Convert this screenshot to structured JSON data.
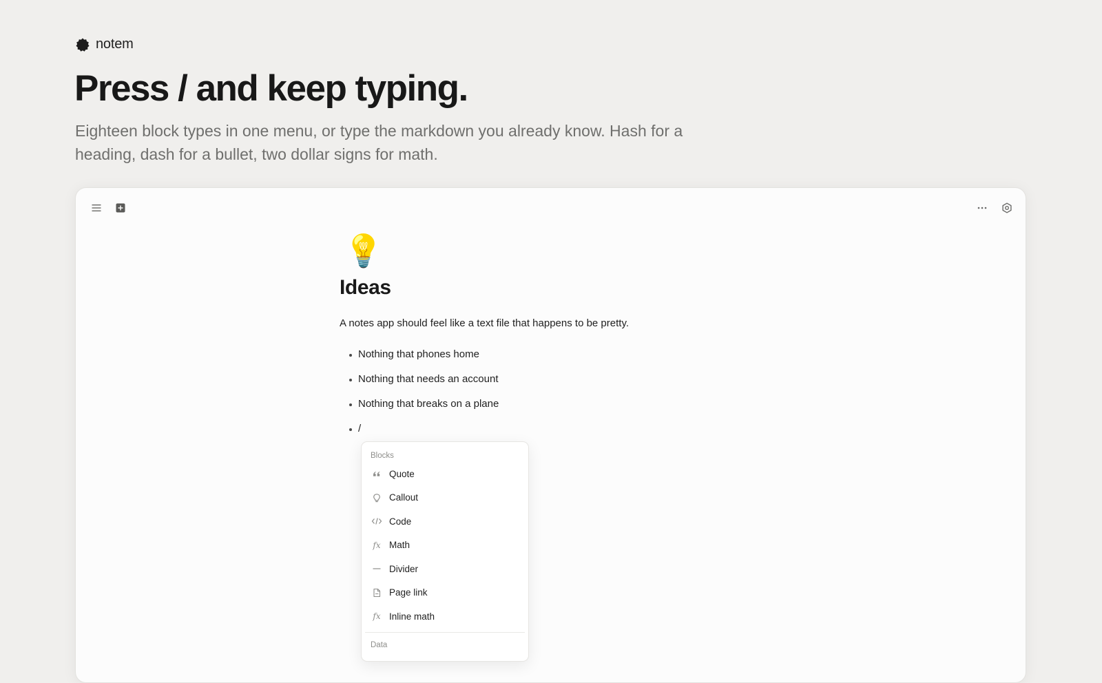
{
  "brand": {
    "name": "notem"
  },
  "hero": {
    "title": "Press / and keep typing.",
    "subtitle": "Eighteen block types in one menu, or type the markdown you already know. Hash for a heading, dash for a bullet, two dollar signs for math."
  },
  "toolbar": {
    "left_icons": [
      "menu-icon",
      "new-page-icon"
    ],
    "right_icons": [
      "more-icon",
      "settings-icon"
    ]
  },
  "document": {
    "emoji": "💡",
    "title": "Ideas",
    "paragraph": "A notes app should feel like a text file that happens to be pretty.",
    "bullets": [
      "Nothing that phones home",
      "Nothing that needs an account",
      "Nothing that breaks on a plane",
      "/"
    ]
  },
  "slash_menu": {
    "section_blocks": "Blocks",
    "items": [
      {
        "label": "Quote",
        "icon": "quote-icon"
      },
      {
        "label": "Callout",
        "icon": "callout-icon"
      },
      {
        "label": "Code",
        "icon": "code-icon"
      },
      {
        "label": "Math",
        "icon": "math-icon"
      },
      {
        "label": "Divider",
        "icon": "divider-icon"
      },
      {
        "label": "Page link",
        "icon": "page-link-icon"
      },
      {
        "label": "Inline math",
        "icon": "inline-math-icon"
      }
    ],
    "section_data": "Data"
  },
  "colors": {
    "background": "#f0efed",
    "window": "#fcfcfc",
    "text": "#1c1c1c",
    "muted": "#6f6f6d"
  }
}
